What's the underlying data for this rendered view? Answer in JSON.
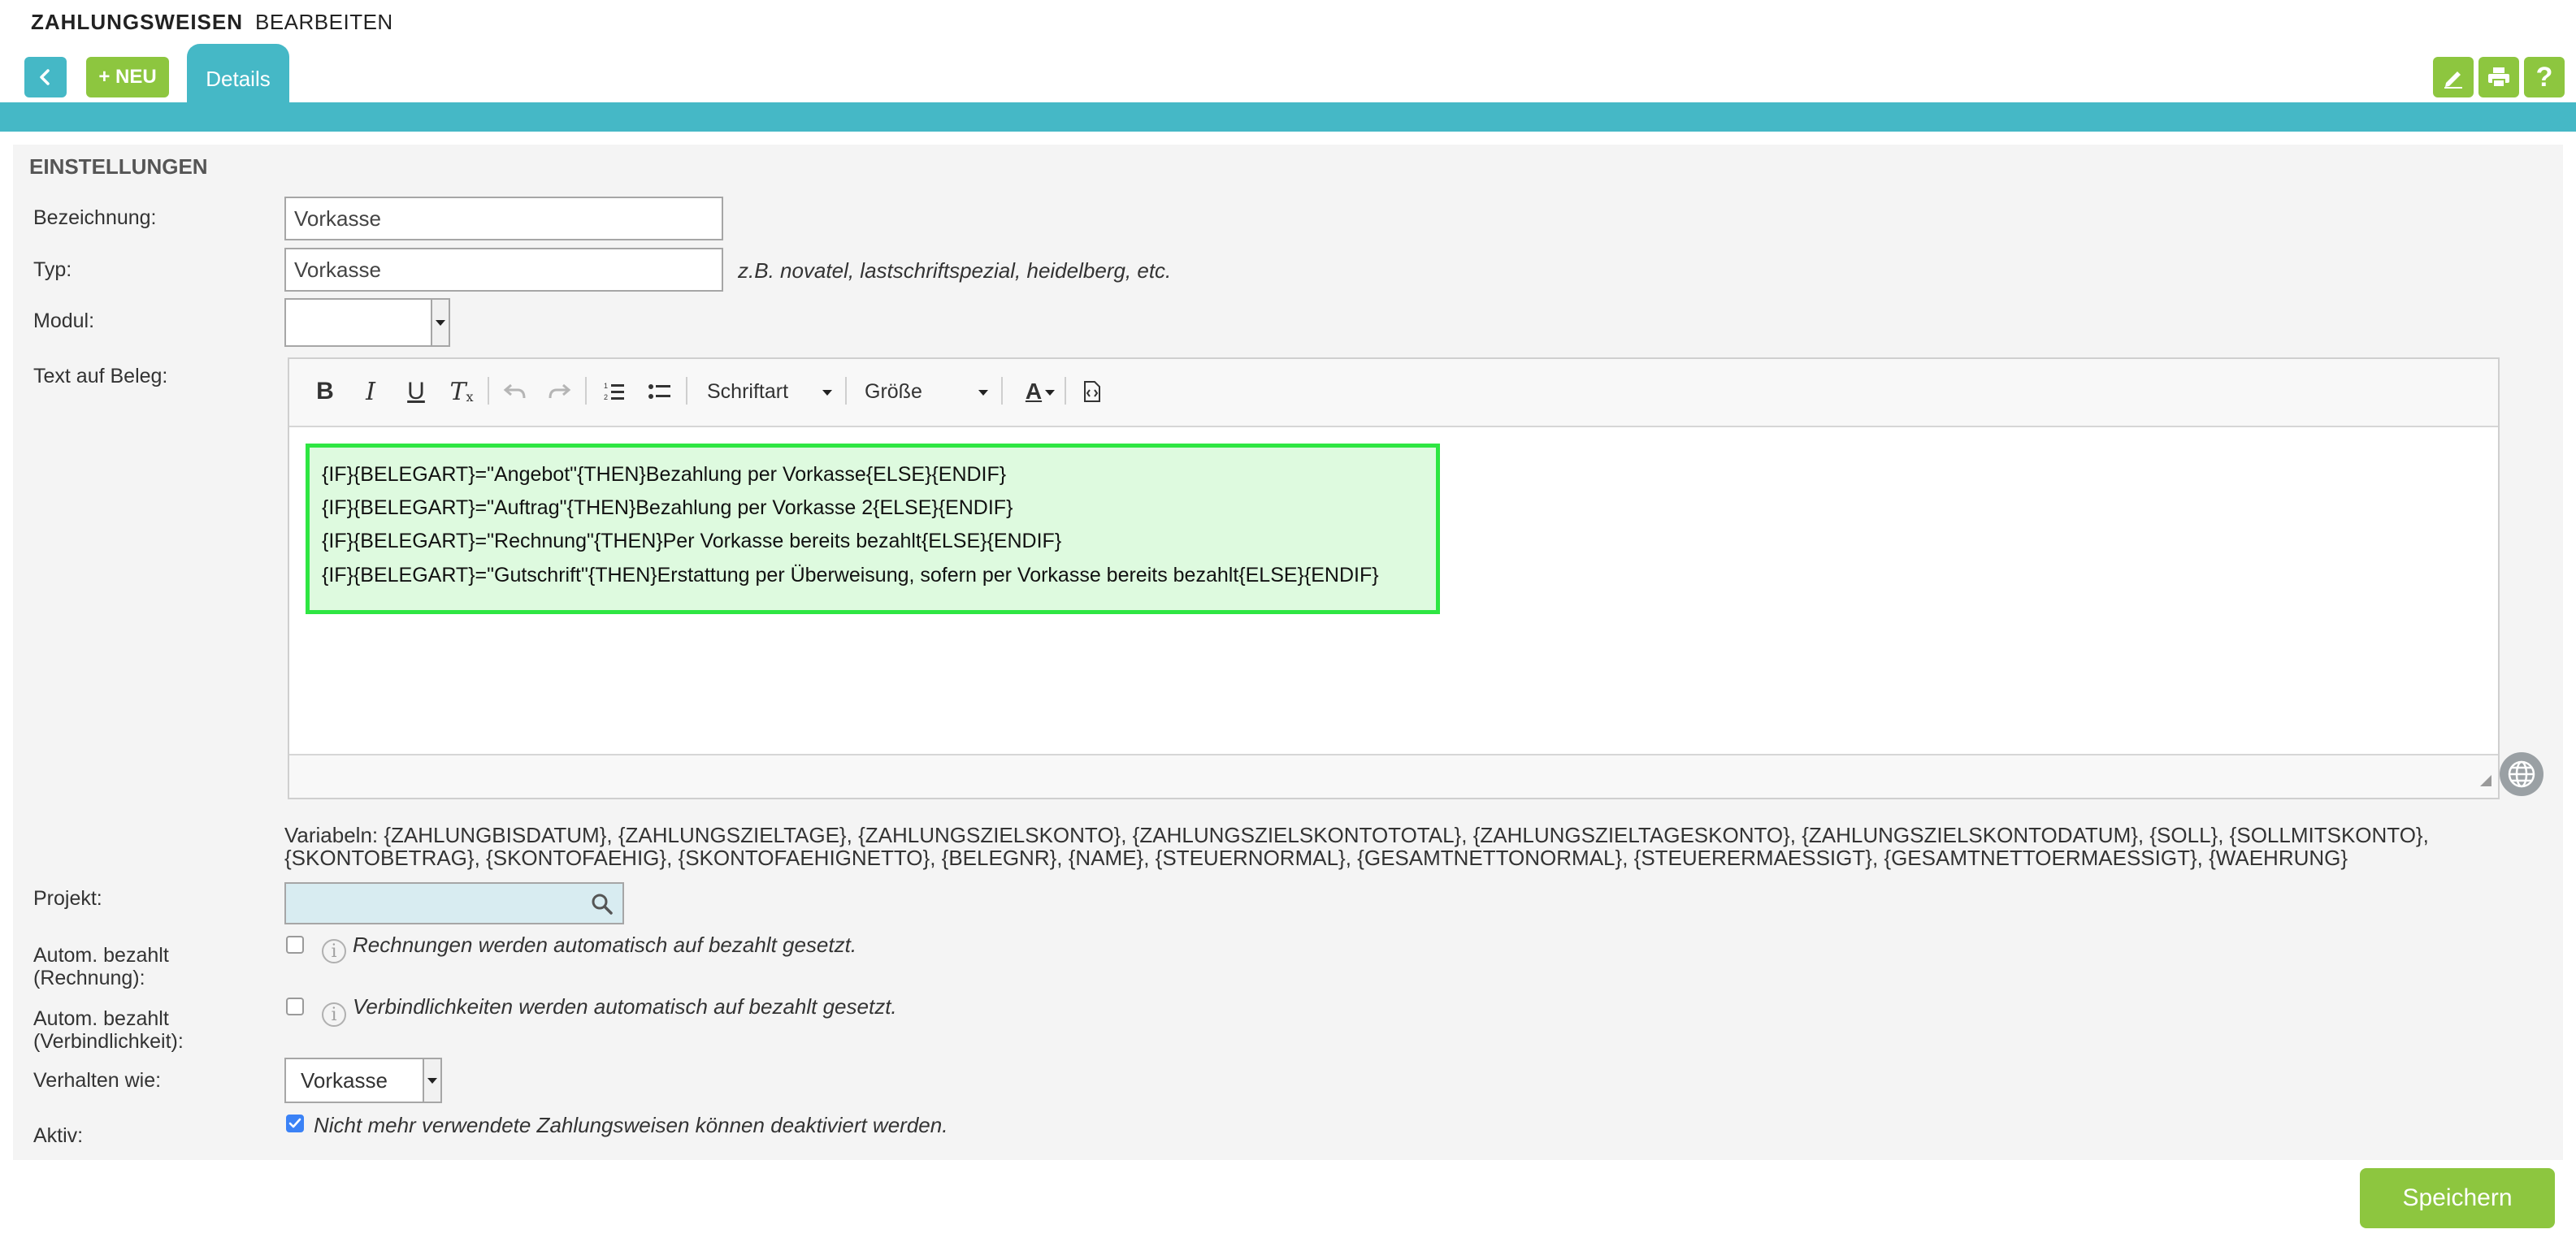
{
  "breadcrumb": {
    "title": "ZAHLUNGSWEISEN",
    "action": "BEARBEITEN"
  },
  "nav": {
    "neu_label": "+ NEU",
    "tab_details": "Details"
  },
  "toolbar_icons": [
    "edit-icon",
    "print-icon",
    "help-icon"
  ],
  "toolbar": {
    "help_label": "?"
  },
  "section": {
    "title": "EINSTELLUNGEN"
  },
  "form": {
    "bezeichnung": {
      "label": "Bezeichnung:",
      "value": "Vorkasse"
    },
    "typ": {
      "label": "Typ:",
      "value": "Vorkasse",
      "hint": "z.B. novatel, lastschriftspezial, heidelberg, etc."
    },
    "modul": {
      "label": "Modul:",
      "value": ""
    },
    "text_auf_beleg": {
      "label": "Text auf Beleg:",
      "toolbar": {
        "font_label": "Schriftart",
        "size_label": "Größe"
      },
      "lines": [
        "{IF}{BELEGART}=\"Angebot\"{THEN}Bezahlung per Vorkasse{ELSE}{ENDIF}",
        "{IF}{BELEGART}=\"Auftrag\"{THEN}Bezahlung per Vorkasse 2{ELSE}{ENDIF}",
        "{IF}{BELEGART}=\"Rechnung\"{THEN}Per Vorkasse bereits bezahlt{ELSE}{ENDIF}",
        "{IF}{BELEGART}=\"Gutschrift\"{THEN}Erstattung per Überweisung, sofern per Vorkasse bereits bezahlt{ELSE}{ENDIF}"
      ]
    },
    "variabeln": {
      "line1": "Variabeln: {ZAHLUNGBISDATUM}, {ZAHLUNGSZIELTAGE}, {ZAHLUNGSZIELSKONTO}, {ZAHLUNGSZIELSKONTOTOTAL}, {ZAHLUNGSZIELTAGESKONTO}, {ZAHLUNGSZIELSKONTODATUM}, {SOLL}, {SOLLMITSKONTO},",
      "line2": "{SKONTOBETRAG}, {SKONTOFAEHIG}, {SKONTOFAEHIGNETTO}, {BELEGNR}, {NAME}, {STEUERNORMAL}, {GESAMTNETTONORMAL}, {STEUERERMAESSIGT}, {GESAMTNETTOERMAESSIGT}, {WAEHRUNG}"
    },
    "projekt": {
      "label": "Projekt:",
      "value": ""
    },
    "autom_rechnung": {
      "label_line1": "Autom. bezahlt",
      "label_line2": "(Rechnung):",
      "checked": false,
      "hint": "Rechnungen werden automatisch auf bezahlt gesetzt."
    },
    "autom_verbindlichkeit": {
      "label_line1": "Autom. bezahlt",
      "label_line2": "(Verbindlichkeit):",
      "checked": false,
      "hint": "Verbindlichkeiten werden automatisch auf bezahlt gesetzt."
    },
    "verhalten_wie": {
      "label": "Verhalten wie:",
      "value": "Vorkasse"
    },
    "aktiv": {
      "label": "Aktiv:",
      "checked": true,
      "hint": "Nicht mehr verwendete Zahlungsweisen können deaktiviert werden."
    }
  },
  "footer": {
    "save_label": "Speichern"
  },
  "colors": {
    "accent": "#45b8c6",
    "green": "#8dc63f",
    "highlight_border": "#2ee642",
    "highlight_bg": "#defadf"
  }
}
